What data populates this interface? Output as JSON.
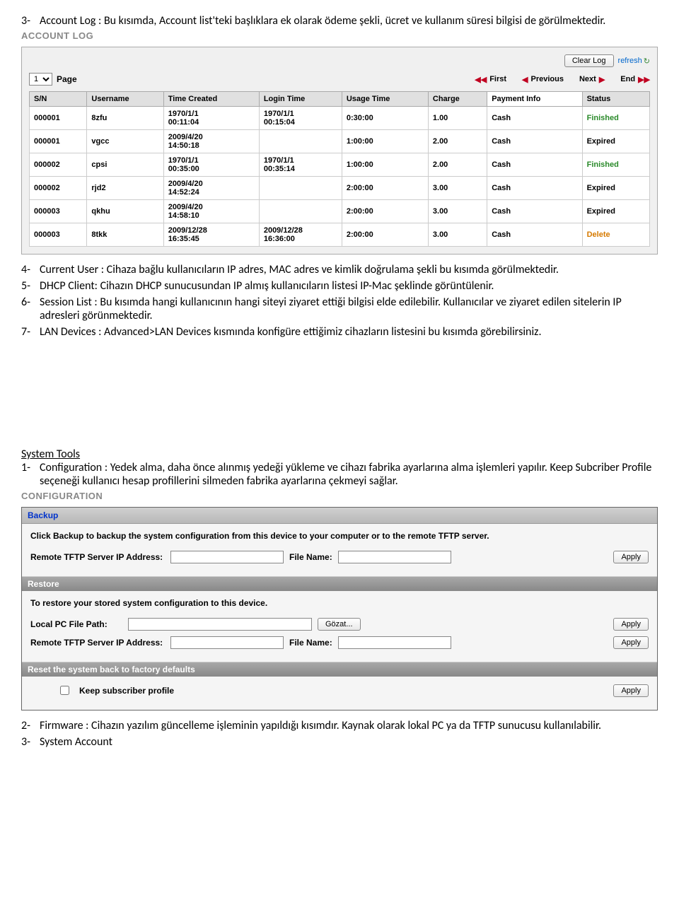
{
  "intro": {
    "item3_num": "3-",
    "item3": "Account Log : Bu kısımda, Account list'teki başlıklara ek olarak ödeme şekli, ücret ve kullanım süresi bilgisi de görülmektedir."
  },
  "account_log": {
    "label": "ACCOUNT LOG",
    "clear_log": "Clear Log",
    "refresh": "refresh",
    "page_select": "1",
    "page_label": "Page",
    "nav": {
      "first": "First",
      "previous": "Previous",
      "next": "Next",
      "end": "End"
    },
    "headers": [
      "S/N",
      "Username",
      "Time Created",
      "Login Time",
      "Usage Time",
      "Charge",
      "Payment Info",
      "Status"
    ],
    "rows": [
      {
        "sn": "000001",
        "user": "8zfu",
        "created": "1970/1/1\n00:11:04",
        "login": "1970/1/1\n00:15:04",
        "usage": "0:30:00",
        "charge": "1.00",
        "pay": "Cash",
        "status": "Finished",
        "status_class": "status-finished"
      },
      {
        "sn": "000001",
        "user": "vgcc",
        "created": "2009/4/20\n14:50:18",
        "login": "",
        "usage": "1:00:00",
        "charge": "2.00",
        "pay": "Cash",
        "status": "Expired",
        "status_class": "status-expired"
      },
      {
        "sn": "000002",
        "user": "cpsi",
        "created": "1970/1/1\n00:35:00",
        "login": "1970/1/1\n00:35:14",
        "usage": "1:00:00",
        "charge": "2.00",
        "pay": "Cash",
        "status": "Finished",
        "status_class": "status-finished"
      },
      {
        "sn": "000002",
        "user": "rjd2",
        "created": "2009/4/20\n14:52:24",
        "login": "",
        "usage": "2:00:00",
        "charge": "3.00",
        "pay": "Cash",
        "status": "Expired",
        "status_class": "status-expired"
      },
      {
        "sn": "000003",
        "user": "qkhu",
        "created": "2009/4/20\n14:58:10",
        "login": "",
        "usage": "2:00:00",
        "charge": "3.00",
        "pay": "Cash",
        "status": "Expired",
        "status_class": "status-expired"
      },
      {
        "sn": "000003",
        "user": "8tkk",
        "created": "2009/12/28\n16:35:45",
        "login": "2009/12/28\n16:36:00",
        "usage": "2:00:00",
        "charge": "3.00",
        "pay": "Cash",
        "status": "Delete",
        "status_class": "status-delete"
      }
    ]
  },
  "after_panel": {
    "item4_num": "4-",
    "item4": "Current User : Cihaza bağlu kullanıcıların IP adres, MAC adres ve kimlik doğrulama şekli bu kısımda görülmektedir.",
    "item5_num": "5-",
    "item5": "DHCP Client: Cihazın DHCP sunucusundan IP almış kullanıcıların listesi IP-Mac şeklinde görüntülenir.",
    "item6_num": "6-",
    "item6": "Session List : Bu kısımda hangi kullanıcının hangi siteyi ziyaret ettiği bilgisi elde edilebilir. Kullanıcılar ve ziyaret edilen sitelerin IP adresleri görünmektedir.",
    "item7_num": "7-",
    "item7": "LAN Devices : Advanced>LAN Devices kısmında konfigüre ettiğimiz cihazların listesini bu kısımda görebilirsiniz."
  },
  "system_tools": {
    "title": "System Tools",
    "item1_num": "1-",
    "item1": "Configuration :  Yedek alma, daha önce alınmış yedeği yükleme ve cihazı fabrika ayarlarına alma işlemleri yapılır. Keep Subcriber Profile seçeneği kullanıcı hesap profillerini silmeden fabrika ayarlarına çekmeyi sağlar."
  },
  "configuration": {
    "label": "CONFIGURATION",
    "backup_header": "Backup",
    "backup_desc": "Click Backup to backup the system configuration from this device to your computer or to the remote TFTP server.",
    "tftp_label": "Remote TFTP Server IP Address:",
    "file_label": "File Name:",
    "apply": "Apply",
    "restore_header": "Restore",
    "restore_desc": "To restore your stored system configuration to this device.",
    "local_path_label": "Local PC File Path:",
    "browse": "Gözat...",
    "reset_header": "Reset the system back to factory defaults",
    "keep_profile": "Keep subscriber profile"
  },
  "footer": {
    "item2_num": "2-",
    "item2": "Firmware : Cihazın yazılım güncelleme işleminin yapıldığı kısımdır. Kaynak olarak lokal PC ya da TFTP sunucusu kullanılabilir.",
    "item3_num": "3-",
    "item3": "System Account"
  }
}
